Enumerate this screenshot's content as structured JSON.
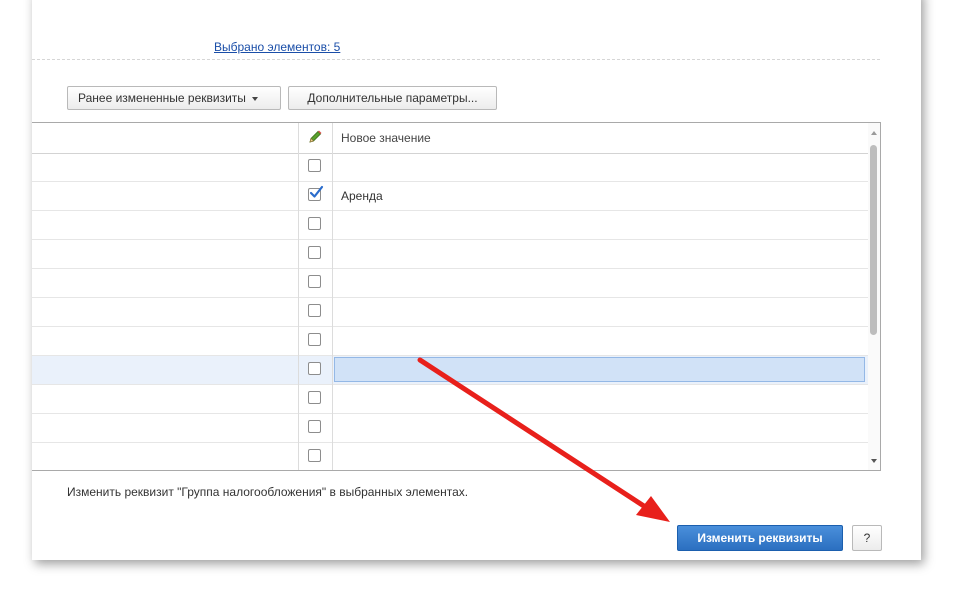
{
  "header": {
    "selected_link": "Выбрано элементов: 5"
  },
  "toolbar": {
    "prev_changed_label": "Ранее измененные реквизиты",
    "extra_params_label": "Дополнительные параметры..."
  },
  "grid": {
    "column_header": "Новое значение",
    "rows": [
      {
        "checked": false,
        "value": ""
      },
      {
        "checked": true,
        "value": "Аренда"
      },
      {
        "checked": false,
        "value": ""
      },
      {
        "checked": false,
        "value": ""
      },
      {
        "checked": false,
        "value": ""
      },
      {
        "checked": false,
        "value": ""
      },
      {
        "checked": false,
        "value": ""
      },
      {
        "checked": false,
        "value": "",
        "active": true
      },
      {
        "checked": false,
        "value": ""
      },
      {
        "checked": false,
        "value": ""
      },
      {
        "checked": false,
        "value": ""
      }
    ]
  },
  "footer": {
    "hint": "Изменить реквизит \"Группа налогообложения\" в выбранных элементах.",
    "apply_label": "Изменить реквизиты",
    "help_label": "?"
  },
  "colors": {
    "accent": "#2b6fc0",
    "annotation_arrow": "#e8201b",
    "selection": "#d1e2f7"
  }
}
